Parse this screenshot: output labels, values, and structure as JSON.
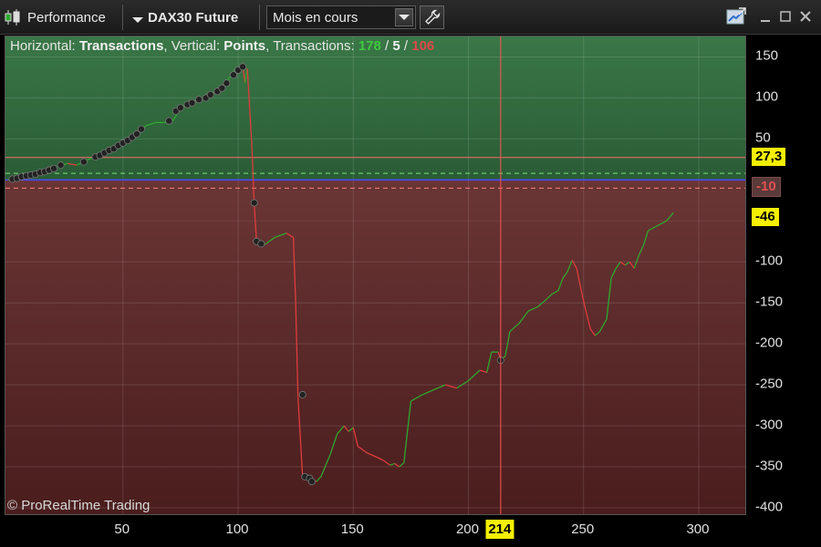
{
  "toolbar": {
    "performance_label": "Performance",
    "instrument_label": "DAX30 Future",
    "period_value": "Mois en cours"
  },
  "legend": {
    "horizontal_prefix": "Horizontal: ",
    "horizontal_value": "Transactions",
    "vertical_prefix": ", Vertical: ",
    "vertical_value": "Points",
    "transactions_prefix": ", Transactions: ",
    "winning": "178",
    "sep1": " / ",
    "neutral": "5",
    "sep2": " / ",
    "losing": "106"
  },
  "copyright": "© ProRealTime Trading",
  "tags": {
    "upper_line": "27,3",
    "zero_line": "-10",
    "lower_line": "-46",
    "cursor_x": "214"
  },
  "colors": {
    "profit_zone": "#2f6a3b",
    "loss_zone": "#5b2424",
    "gain_line": "#2ea82e",
    "loss_line": "#e03c3c",
    "tag_yellow": "#f5f000",
    "cursor": "#ff5050"
  },
  "chart_data": {
    "type": "line",
    "xlabel": "",
    "ylabel": "",
    "xlim": [
      -1,
      321
    ],
    "ylim": [
      -410,
      175
    ],
    "x_ticks": [
      50,
      100,
      150,
      200,
      250,
      300
    ],
    "y_ticks": [
      150,
      100,
      50,
      -100,
      -150,
      -200,
      -250,
      -300,
      -350,
      -400
    ],
    "reference_lines": {
      "upper": 27.3,
      "green_dashed": 8,
      "blue": 0,
      "red_dashed": -10,
      "lower": -46
    },
    "cursor": {
      "x": 214,
      "y": -220
    },
    "series": [
      {
        "points": [
          [
            0,
            0
          ],
          [
            5,
            3
          ],
          [
            10,
            6
          ],
          [
            15,
            10
          ],
          [
            20,
            14
          ],
          [
            23,
            18
          ],
          [
            26,
            20
          ],
          [
            30,
            18
          ],
          [
            34,
            24
          ],
          [
            38,
            28
          ],
          [
            41,
            32
          ],
          [
            44,
            36
          ],
          [
            47,
            40
          ],
          [
            50,
            45
          ],
          [
            53,
            50
          ],
          [
            56,
            56
          ],
          [
            58,
            62
          ],
          [
            60,
            66
          ],
          [
            64,
            70
          ],
          [
            68,
            70
          ],
          [
            71,
            70
          ],
          [
            73,
            78
          ],
          [
            75,
            88
          ],
          [
            78,
            92
          ],
          [
            81,
            96
          ],
          [
            84,
            100
          ],
          [
            87,
            102
          ],
          [
            90,
            108
          ],
          [
            93,
            112
          ],
          [
            96,
            124
          ],
          [
            99,
            136
          ],
          [
            101,
            138
          ],
          [
            102,
            140
          ],
          [
            103,
            118
          ],
          [
            104,
            136
          ],
          [
            106,
            40
          ],
          [
            107,
            -30
          ],
          [
            108,
            -75
          ],
          [
            110,
            -80
          ],
          [
            112,
            -78
          ],
          [
            116,
            -70
          ],
          [
            121,
            -65
          ],
          [
            124,
            -70
          ],
          [
            125,
            -150
          ],
          [
            126,
            -265
          ],
          [
            128,
            -362
          ],
          [
            131,
            -366
          ],
          [
            134,
            -368
          ],
          [
            136,
            -362
          ],
          [
            140,
            -335
          ],
          [
            143,
            -310
          ],
          [
            146,
            -300
          ],
          [
            148,
            -307
          ],
          [
            150,
            -302
          ],
          [
            152,
            -325
          ],
          [
            156,
            -333
          ],
          [
            160,
            -338
          ],
          [
            163,
            -342
          ],
          [
            166,
            -348
          ],
          [
            168,
            -346
          ],
          [
            170,
            -350
          ],
          [
            172,
            -345
          ],
          [
            175,
            -270
          ],
          [
            180,
            -262
          ],
          [
            185,
            -256
          ],
          [
            190,
            -250
          ],
          [
            195,
            -254
          ],
          [
            200,
            -245
          ],
          [
            205,
            -232
          ],
          [
            208,
            -235
          ],
          [
            210,
            -210
          ],
          [
            213,
            -210
          ],
          [
            214,
            -220
          ],
          [
            216,
            -215
          ],
          [
            218,
            -185
          ],
          [
            222,
            -175
          ],
          [
            226,
            -160
          ],
          [
            230,
            -155
          ],
          [
            233,
            -148
          ],
          [
            236,
            -140
          ],
          [
            239,
            -135
          ],
          [
            241,
            -120
          ],
          [
            243,
            -112
          ],
          [
            245,
            -98
          ],
          [
            247,
            -108
          ],
          [
            249,
            -135
          ],
          [
            251,
            -160
          ],
          [
            253,
            -182
          ],
          [
            255,
            -190
          ],
          [
            257,
            -185
          ],
          [
            260,
            -170
          ],
          [
            262,
            -120
          ],
          [
            264,
            -108
          ],
          [
            266,
            -100
          ],
          [
            268,
            -104
          ],
          [
            270,
            -100
          ],
          [
            272,
            -108
          ],
          [
            274,
            -92
          ],
          [
            276,
            -80
          ],
          [
            278,
            -62
          ],
          [
            282,
            -56
          ],
          [
            286,
            -50
          ],
          [
            289,
            -40
          ]
        ]
      }
    ],
    "markers": [
      [
        2,
        1
      ],
      [
        4,
        2
      ],
      [
        6,
        4
      ],
      [
        8,
        5
      ],
      [
        10,
        6
      ],
      [
        12,
        7
      ],
      [
        14,
        9
      ],
      [
        16,
        10
      ],
      [
        18,
        12
      ],
      [
        20,
        14
      ],
      [
        23,
        18
      ],
      [
        33,
        22
      ],
      [
        38,
        28
      ],
      [
        40,
        30
      ],
      [
        42,
        33
      ],
      [
        44,
        36
      ],
      [
        46,
        38
      ],
      [
        48,
        42
      ],
      [
        50,
        45
      ],
      [
        52,
        48
      ],
      [
        54,
        52
      ],
      [
        56,
        56
      ],
      [
        58,
        62
      ],
      [
        70,
        72
      ],
      [
        73,
        84
      ],
      [
        75,
        88
      ],
      [
        78,
        92
      ],
      [
        80,
        94
      ],
      [
        83,
        98
      ],
      [
        86,
        100
      ],
      [
        88,
        104
      ],
      [
        91,
        108
      ],
      [
        93,
        112
      ],
      [
        95,
        118
      ],
      [
        98,
        128
      ],
      [
        100,
        134
      ],
      [
        102,
        138
      ],
      [
        107,
        -28
      ],
      [
        108,
        -75
      ],
      [
        110,
        -78
      ],
      [
        128,
        -262
      ],
      [
        129,
        -362
      ],
      [
        131,
        -364
      ],
      [
        132,
        -368
      ],
      [
        214,
        -220
      ]
    ]
  }
}
